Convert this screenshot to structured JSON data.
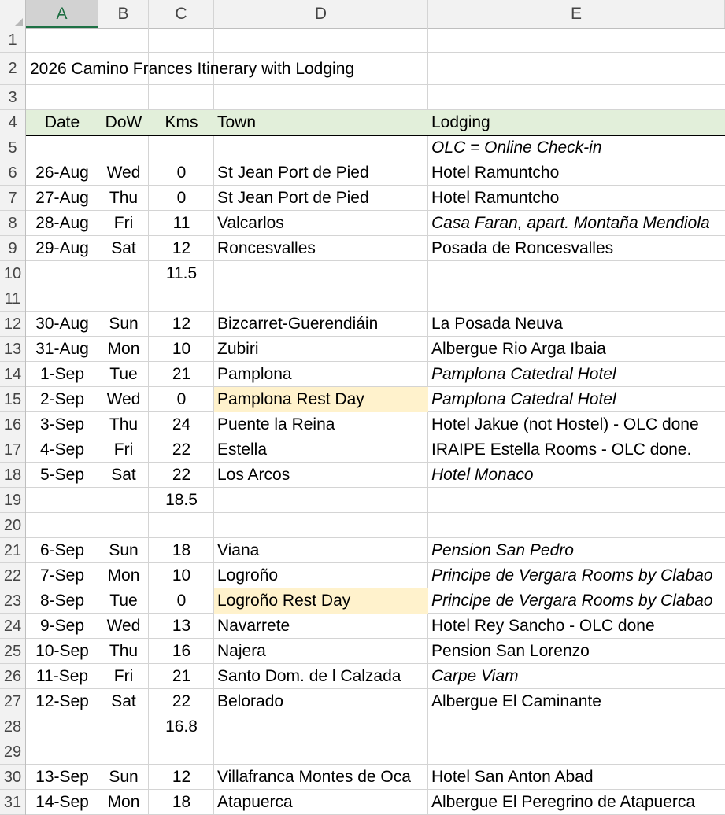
{
  "column_headers": [
    "A",
    "B",
    "C",
    "D",
    "E"
  ],
  "selected_column": "A",
  "row_numbers": [
    "1",
    "2",
    "3",
    "4",
    "5",
    "6",
    "7",
    "8",
    "9",
    "10",
    "11",
    "12",
    "13",
    "14",
    "15",
    "16",
    "17",
    "18",
    "19",
    "20",
    "21",
    "22",
    "23",
    "24",
    "25",
    "26",
    "27",
    "28",
    "29",
    "30",
    "31"
  ],
  "title": "2026 Camino Frances Itinerary with Lodging",
  "header": {
    "date": "Date",
    "dow": "DoW",
    "kms": "Kms",
    "town": "Town",
    "lodging": "Lodging"
  },
  "note": "OLC = Online Check-in",
  "colors": {
    "header_fill": "#e2efda",
    "rest_day_fill": "#fff2cc",
    "selected_col": "#1e7145"
  },
  "rows": [
    {
      "row": 6,
      "date": "26-Aug",
      "dow": "Wed",
      "kms": "0",
      "town": "St Jean Port de Pied",
      "lodging": "Hotel Ramuntcho",
      "lodging_italic": false,
      "rest": false
    },
    {
      "row": 7,
      "date": "27-Aug",
      "dow": "Thu",
      "kms": "0",
      "town": "St Jean Port de Pied",
      "lodging": "Hotel Ramuntcho",
      "lodging_italic": false,
      "rest": false
    },
    {
      "row": 8,
      "date": "28-Aug",
      "dow": "Fri",
      "kms": "11",
      "town": "Valcarlos",
      "lodging": "Casa Faran, apart. Montaña Mendiola",
      "lodging_italic": true,
      "rest": false
    },
    {
      "row": 9,
      "date": "29-Aug",
      "dow": "Sat",
      "kms": "12",
      "town": "Roncesvalles",
      "lodging": "Posada de Roncesvalles",
      "lodging_italic": false,
      "rest": false
    },
    {
      "row": 10,
      "date": "",
      "dow": "",
      "kms": "11.5",
      "town": "",
      "lodging": "",
      "lodging_italic": false,
      "rest": false
    },
    {
      "row": 12,
      "date": "30-Aug",
      "dow": "Sun",
      "kms": "12",
      "town": "Bizcarret-Guerendiáin",
      "lodging": "La Posada Neuva",
      "lodging_italic": false,
      "rest": false
    },
    {
      "row": 13,
      "date": "31-Aug",
      "dow": "Mon",
      "kms": "10",
      "town": "Zubiri",
      "lodging": "Albergue Rio Arga Ibaia",
      "lodging_italic": false,
      "rest": false
    },
    {
      "row": 14,
      "date": "1-Sep",
      "dow": "Tue",
      "kms": "21",
      "town": "Pamplona",
      "lodging": "Pamplona Catedral Hotel",
      "lodging_italic": true,
      "rest": false
    },
    {
      "row": 15,
      "date": "2-Sep",
      "dow": "Wed",
      "kms": "0",
      "town": "Pamplona Rest Day",
      "lodging": "Pamplona Catedral Hotel",
      "lodging_italic": true,
      "rest": true
    },
    {
      "row": 16,
      "date": "3-Sep",
      "dow": "Thu",
      "kms": "24",
      "town": "Puente la Reina",
      "lodging": "Hotel Jakue (not Hostel) - OLC done",
      "lodging_italic": false,
      "rest": false
    },
    {
      "row": 17,
      "date": "4-Sep",
      "dow": "Fri",
      "kms": "22",
      "town": "Estella",
      "lodging": "IRAIPE Estella Rooms - OLC done.",
      "lodging_italic": false,
      "rest": false
    },
    {
      "row": 18,
      "date": "5-Sep",
      "dow": "Sat",
      "kms": "22",
      "town": "Los Arcos",
      "lodging": "Hotel Monaco",
      "lodging_italic": true,
      "rest": false
    },
    {
      "row": 19,
      "date": "",
      "dow": "",
      "kms": "18.5",
      "town": "",
      "lodging": "",
      "lodging_italic": false,
      "rest": false
    },
    {
      "row": 21,
      "date": "6-Sep",
      "dow": "Sun",
      "kms": "18",
      "town": "Viana",
      "lodging": "Pension San Pedro",
      "lodging_italic": true,
      "rest": false
    },
    {
      "row": 22,
      "date": "7-Sep",
      "dow": "Mon",
      "kms": "10",
      "town": "Logroño",
      "lodging": "Principe de Vergara Rooms by Clabao",
      "lodging_italic": true,
      "rest": false
    },
    {
      "row": 23,
      "date": "8-Sep",
      "dow": "Tue",
      "kms": "0",
      "town": "Logroño Rest Day",
      "lodging": "Principe de Vergara Rooms by Clabao",
      "lodging_italic": true,
      "rest": true
    },
    {
      "row": 24,
      "date": "9-Sep",
      "dow": "Wed",
      "kms": "13",
      "town": "Navarrete",
      "lodging": "Hotel Rey Sancho - OLC done",
      "lodging_italic": false,
      "rest": false
    },
    {
      "row": 25,
      "date": "10-Sep",
      "dow": "Thu",
      "kms": "16",
      "town": "Najera",
      "lodging": "Pension San Lorenzo",
      "lodging_italic": false,
      "rest": false
    },
    {
      "row": 26,
      "date": "11-Sep",
      "dow": "Fri",
      "kms": "21",
      "town": "Santo Dom. de l Calzada",
      "lodging": "Carpe Viam",
      "lodging_italic": true,
      "rest": false
    },
    {
      "row": 27,
      "date": "12-Sep",
      "dow": "Sat",
      "kms": "22",
      "town": "Belorado",
      "lodging": "Albergue El Caminante",
      "lodging_italic": false,
      "rest": false
    },
    {
      "row": 28,
      "date": "",
      "dow": "",
      "kms": "16.8",
      "town": "",
      "lodging": "",
      "lodging_italic": false,
      "rest": false
    },
    {
      "row": 30,
      "date": "13-Sep",
      "dow": "Sun",
      "kms": "12",
      "town": "Villafranca Montes de Oca",
      "lodging": "Hotel San Anton Abad",
      "lodging_italic": false,
      "rest": false
    },
    {
      "row": 31,
      "date": "14-Sep",
      "dow": "Mon",
      "kms": "18",
      "town": "Atapuerca",
      "lodging": "Albergue El Peregrino de Atapuerca",
      "lodging_italic": false,
      "rest": false
    }
  ]
}
